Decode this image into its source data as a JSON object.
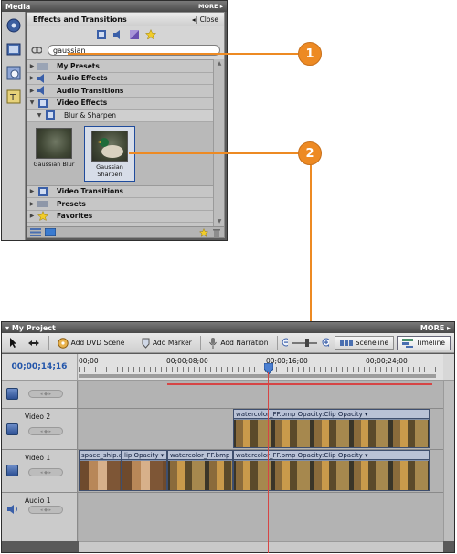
{
  "media": {
    "panel_title": "Media",
    "more": "MORE ▸",
    "effects_title": "Effects and Transitions",
    "close_label": "◂| Close",
    "search_value": "gaussian",
    "tree": [
      {
        "label": "My Presets"
      },
      {
        "label": "Audio Effects"
      },
      {
        "label": "Audio Transitions"
      },
      {
        "label": "Video Effects"
      }
    ],
    "subfolder": "Blur & Sharpen",
    "thumbs": [
      {
        "label": "Gaussian Blur"
      },
      {
        "label": "Gaussian Sharpen"
      }
    ],
    "tree_after": [
      {
        "label": "Video Transitions"
      },
      {
        "label": "Presets"
      },
      {
        "label": "Favorites"
      }
    ]
  },
  "callouts": [
    "1",
    "2"
  ],
  "project": {
    "panel_title": "My Project",
    "more": "MORE ▸",
    "toolbar": {
      "add_dvd": "Add DVD Scene",
      "add_marker": "Add Marker",
      "add_narration": "Add Narration",
      "sceneline": "Sceneline",
      "timeline": "Timeline"
    },
    "timecode": "00;00;14;16",
    "ruler": [
      "00;00",
      "00;00;08;00",
      "00;00;16;00",
      "00;00;24;00"
    ],
    "tracks": [
      {
        "name": ""
      },
      {
        "name": "Video 2"
      },
      {
        "name": "Video 1"
      },
      {
        "name": "Audio 1"
      }
    ],
    "clips": {
      "v2_clip": "watercolor_FF.bmp Opacity:Clip Opacity ▾",
      "v1_space": "space_ship.avi",
      "v1_opacity": "lip Opacity ▾",
      "v1_water": "watercolor_FF.bmp",
      "v1_clip2": "watercolor_FF.bmp Opacity:Clip Opacity ▾"
    }
  }
}
